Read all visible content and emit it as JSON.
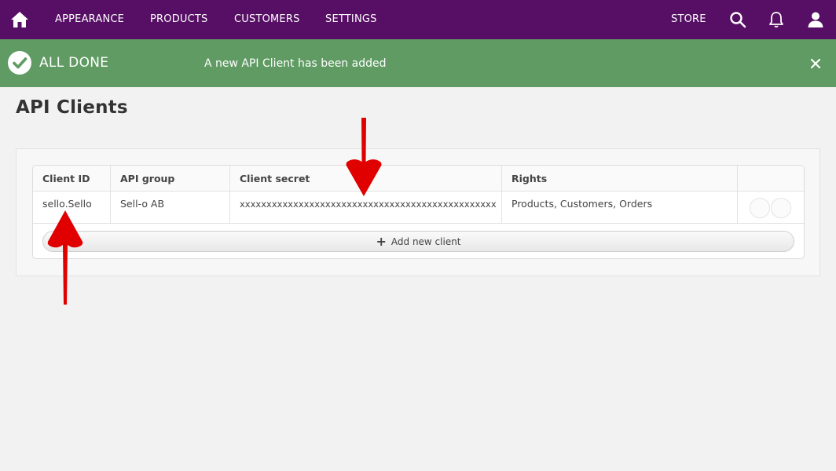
{
  "nav": {
    "items": [
      "APPEARANCE",
      "PRODUCTS",
      "CUSTOMERS",
      "SETTINGS"
    ],
    "store_label": "STORE",
    "icons": [
      "home-icon",
      "search-icon",
      "bell-icon",
      "user-icon"
    ]
  },
  "alert": {
    "title": "ALL DONE",
    "message": "A new API Client has been added",
    "color": "#5f9b62"
  },
  "page": {
    "title": "API Clients"
  },
  "table": {
    "headers": [
      "Client ID",
      "API group",
      "Client secret",
      "Rights",
      ""
    ],
    "rows": [
      {
        "client_id": "sello.Sello",
        "api_group": "Sell-o AB",
        "client_secret": "xxxxxxxxxxxxxxxxxxxxxxxxxxxxxxxxxxxxxxxxxxxxxxxx",
        "rights": "Products, Customers, Orders"
      }
    ],
    "add_label": "Add new client"
  },
  "colors": {
    "nav": "#560f64",
    "annotation": "#e00000"
  }
}
